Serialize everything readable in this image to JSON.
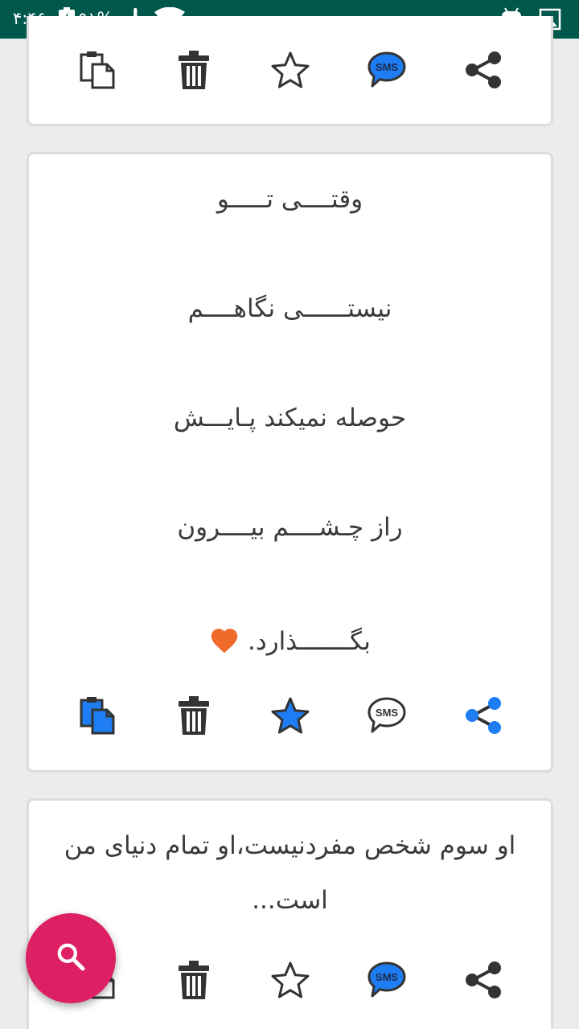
{
  "status_bar": {
    "time": "۴:۴۶",
    "battery": "۹۱%",
    "icons": [
      "battery-charging-icon",
      "airplane-mode-icon",
      "wifi-icon",
      "android-icon",
      "image-icon"
    ]
  },
  "cards": [
    {
      "lines": [],
      "actions": [
        {
          "name": "copy",
          "icon": "copy-icon",
          "active": false
        },
        {
          "name": "delete",
          "icon": "trash-icon",
          "active": false
        },
        {
          "name": "favorite",
          "icon": "star-icon",
          "active": false
        },
        {
          "name": "sms",
          "icon": "sms-icon",
          "active": true
        },
        {
          "name": "share",
          "icon": "share-icon",
          "active": false
        }
      ]
    },
    {
      "lines": [
        "وقتــــی تـــــو",
        "نیستــــــی نگاهــــم",
        "حوصله نمیکند پـایـــش",
        "راز چـشــــم بیــــرون",
        "بگـــــــذارد."
      ],
      "emoji": "heart-icon",
      "actions": [
        {
          "name": "copy",
          "icon": "copy-icon",
          "active": true
        },
        {
          "name": "delete",
          "icon": "trash-icon",
          "active": false
        },
        {
          "name": "favorite",
          "icon": "star-icon",
          "active": true
        },
        {
          "name": "sms",
          "icon": "sms-icon",
          "active": false
        },
        {
          "name": "share",
          "icon": "share-icon",
          "active": true
        }
      ]
    },
    {
      "lines": [
        "او سوم شخص مفردنیست،او تمام دنیای من",
        "است..."
      ],
      "actions": [
        {
          "name": "copy",
          "icon": "copy-icon",
          "active": false
        },
        {
          "name": "delete",
          "icon": "trash-icon",
          "active": false
        },
        {
          "name": "favorite",
          "icon": "star-icon",
          "active": false
        },
        {
          "name": "sms",
          "icon": "sms-icon",
          "active": true
        },
        {
          "name": "share",
          "icon": "share-icon",
          "active": false
        }
      ]
    }
  ],
  "fab": {
    "icon": "search-icon"
  },
  "colors": {
    "status_bar": "#00574b",
    "accent_blue": "#1e7df2",
    "icon_dark": "#333333",
    "fab": "#dd1f63",
    "heart": "#f06a2b"
  }
}
